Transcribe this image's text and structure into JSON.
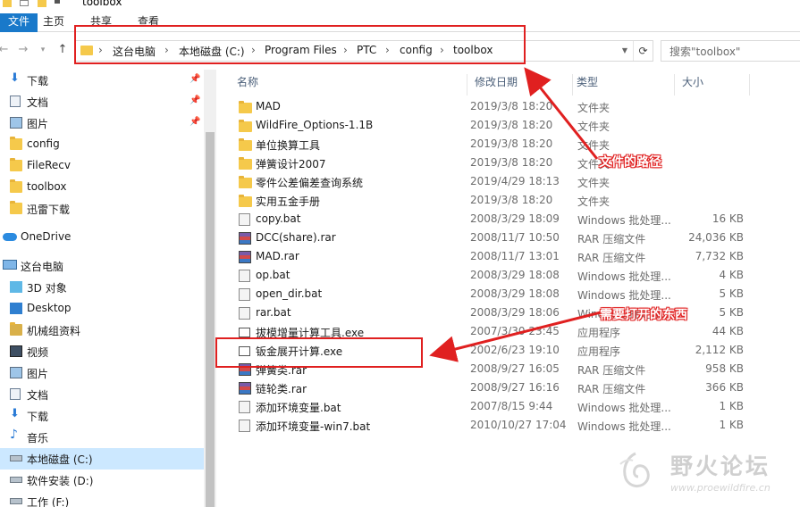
{
  "window": {
    "title": "toolbox"
  },
  "ribbon": {
    "tabs": [
      "文件",
      "主页",
      "共享",
      "查看"
    ]
  },
  "address": {
    "crumbs": [
      "这台电脑",
      "本地磁盘 (C:)",
      "Program Files",
      "PTC",
      "config",
      "toolbox"
    ],
    "separator": "›"
  },
  "search": {
    "placeholder": "搜索\"toolbox\""
  },
  "sidebar": {
    "quick_access": [
      {
        "label": "下载",
        "icon": "download-arrow-icon",
        "pinned": true
      },
      {
        "label": "文档",
        "icon": "document-icon",
        "pinned": true
      },
      {
        "label": "图片",
        "icon": "picture-icon",
        "pinned": true
      },
      {
        "label": "config",
        "icon": "folder-icon",
        "pinned": false
      },
      {
        "label": "FileRecv",
        "icon": "folder-icon",
        "pinned": false
      },
      {
        "label": "toolbox",
        "icon": "folder-icon",
        "pinned": false
      },
      {
        "label": "迅雷下载",
        "icon": "folder-icon",
        "pinned": false
      }
    ],
    "onedrive": {
      "label": "OneDrive",
      "icon": "cloud-icon"
    },
    "this_pc": {
      "label": "这台电脑",
      "icon": "computer-icon"
    },
    "pc_items": [
      {
        "label": "3D 对象",
        "icon": "cube-icon"
      },
      {
        "label": "Desktop",
        "icon": "desktop-icon"
      },
      {
        "label": "机械组资料",
        "icon": "network-folder-icon"
      },
      {
        "label": "视频",
        "icon": "video-icon"
      },
      {
        "label": "图片",
        "icon": "picture-icon"
      },
      {
        "label": "文档",
        "icon": "document-icon"
      },
      {
        "label": "下载",
        "icon": "download-arrow-icon"
      },
      {
        "label": "音乐",
        "icon": "music-note-icon"
      },
      {
        "label": "本地磁盘 (C:)",
        "icon": "drive-icon",
        "selected": true
      },
      {
        "label": "软件安装 (D:)",
        "icon": "drive-icon"
      },
      {
        "label": "工作 (F:)",
        "icon": "drive-icon"
      }
    ]
  },
  "columns": {
    "name": "名称",
    "date": "修改日期",
    "type": "类型",
    "size": "大小"
  },
  "files": [
    {
      "name": "MAD",
      "date": "2019/3/8 18:20",
      "type": "文件夹",
      "size": "",
      "icon": "folder-icon"
    },
    {
      "name": "WildFire_Options-1.1B",
      "date": "2019/3/8 18:20",
      "type": "文件夹",
      "size": "",
      "icon": "folder-icon"
    },
    {
      "name": "单位换算工具",
      "date": "2019/3/8 18:20",
      "type": "文件夹",
      "size": "",
      "icon": "folder-icon"
    },
    {
      "name": "弹簧设计2007",
      "date": "2019/3/8 18:20",
      "type": "文件夹",
      "size": "",
      "icon": "folder-icon"
    },
    {
      "name": "零件公差偏差查询系统",
      "date": "2019/4/29 18:13",
      "type": "文件夹",
      "size": "",
      "icon": "folder-icon"
    },
    {
      "name": "实用五金手册",
      "date": "2019/3/8 18:20",
      "type": "文件夹",
      "size": "",
      "icon": "folder-icon"
    },
    {
      "name": "copy.bat",
      "date": "2008/3/29 18:09",
      "type": "Windows 批处理...",
      "size": "16 KB",
      "icon": "bat-gear-icon"
    },
    {
      "name": "DCC(share).rar",
      "date": "2008/11/7 10:50",
      "type": "RAR 压缩文件",
      "size": "24,036 KB",
      "icon": "rar-archive-icon"
    },
    {
      "name": "MAD.rar",
      "date": "2008/11/7 13:01",
      "type": "RAR 压缩文件",
      "size": "7,732 KB",
      "icon": "rar-archive-icon"
    },
    {
      "name": "op.bat",
      "date": "2008/3/29 18:08",
      "type": "Windows 批处理...",
      "size": "4 KB",
      "icon": "bat-gear-icon"
    },
    {
      "name": "open_dir.bat",
      "date": "2008/3/29 18:08",
      "type": "Windows 批处理...",
      "size": "5 KB",
      "icon": "bat-gear-icon"
    },
    {
      "name": "rar.bat",
      "date": "2008/3/29 18:06",
      "type": "Windows 批处理...",
      "size": "5 KB",
      "icon": "bat-gear-icon"
    },
    {
      "name": "拔模增量计算工具.exe",
      "date": "2007/3/30 23:45",
      "type": "应用程序",
      "size": "44 KB",
      "icon": "exe-app-icon"
    },
    {
      "name": "钣金展开计算.exe",
      "date": "2002/6/23 19:10",
      "type": "应用程序",
      "size": "2,112 KB",
      "icon": "exe-app-icon"
    },
    {
      "name": "弹簧类.rar",
      "date": "2008/9/27 16:05",
      "type": "RAR 压缩文件",
      "size": "958 KB",
      "icon": "rar-archive-icon"
    },
    {
      "name": "链轮类.rar",
      "date": "2008/9/27 16:16",
      "type": "RAR 压缩文件",
      "size": "366 KB",
      "icon": "rar-archive-icon"
    },
    {
      "name": "添加环境变量.bat",
      "date": "2007/8/15 9:44",
      "type": "Windows 批处理...",
      "size": "1 KB",
      "icon": "bat-gear-icon"
    },
    {
      "name": "添加环境变量-win7.bat",
      "date": "2010/10/27 17:04",
      "type": "Windows 批处理...",
      "size": "1 KB",
      "icon": "bat-gear-icon"
    }
  ],
  "annotations": {
    "path_label": "文件的路径",
    "target_label": "需要打开的东西",
    "color": "#e02020"
  },
  "watermark": {
    "text": "野火论坛",
    "url": "www.proewildfire.cn"
  },
  "colors": {
    "accent": "#1979ca",
    "selection": "#cce8ff",
    "folder": "#f5c94b",
    "annotation": "#e02020"
  }
}
